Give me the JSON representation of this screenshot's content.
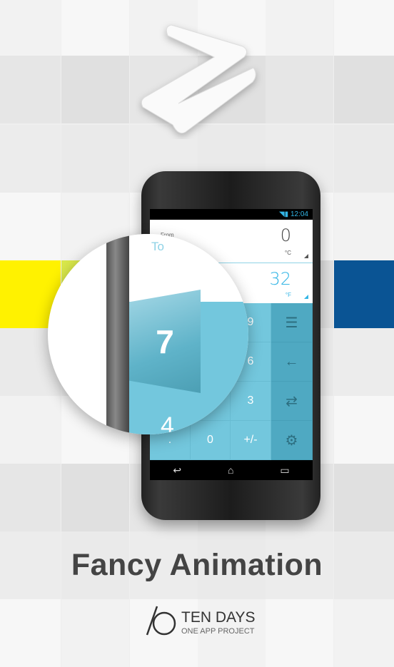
{
  "status_bar": {
    "time": "12:04",
    "icons": [
      "wifi-icon",
      "signal-icon",
      "battery-icon"
    ]
  },
  "converter": {
    "from": {
      "label": "From",
      "value": "0",
      "unit": "°C"
    },
    "to": {
      "label": "To",
      "value": "32",
      "unit": "°F"
    }
  },
  "keypad": {
    "keys": [
      "",
      "",
      "9",
      "",
      "",
      "6",
      "",
      "",
      "3",
      ".",
      "0",
      "+/-"
    ],
    "side_icons": [
      "menu-icon",
      "backspace-icon",
      "swap-icon",
      "settings-icon"
    ]
  },
  "magnifier": {
    "to_label": "To",
    "flip_digit": "7",
    "below_digit": "4"
  },
  "nav_icons": [
    "back-icon",
    "home-icon",
    "recent-apps-icon"
  ],
  "headline": "Fancy Animation",
  "brand": {
    "name": "TEN DAYS",
    "tagline": "ONE APP PROJECT"
  },
  "colors": {
    "accent": "#33b5e5",
    "keypad": "#73c7dd",
    "side": "#4fa9c2",
    "yellow": "#fff200",
    "blue": "#0a5494"
  }
}
